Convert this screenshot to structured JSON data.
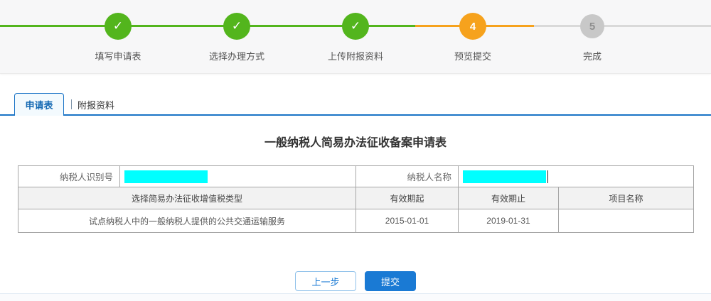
{
  "progress": {
    "steps": [
      {
        "label": "填写申请表",
        "status": "completed"
      },
      {
        "label": "选择办理方式",
        "status": "completed"
      },
      {
        "label": "上传附报资料",
        "status": "completed"
      },
      {
        "label": "预览提交",
        "status": "active",
        "number": "4"
      },
      {
        "label": "完成",
        "status": "pending",
        "number": "5"
      }
    ]
  },
  "icons": {
    "check": "✓"
  },
  "tabs": {
    "application_form": "申请表",
    "attached_materials": "附报资料"
  },
  "form": {
    "title": "一般纳税人简易办法征收备案申请表",
    "taxpayer_id_label": "纳税人识别号",
    "taxpayer_name_label": "纳税人名称",
    "table": {
      "headers": [
        "选择简易办法征收增值税类型",
        "有效期起",
        "有效期止",
        "项目名称"
      ],
      "data_row": {
        "type": "试点纳税人中的一般纳税人提供的公共交通运输服务",
        "valid_from": "2015-01-01",
        "valid_to": "2019-01-31",
        "project_name": ""
      }
    }
  },
  "buttons": {
    "previous": "上一步",
    "submit": "提交"
  },
  "colors": {
    "step_completed_green": "#53b51d",
    "step_active_orange": "#f6a21d",
    "step_pending_gray": "#c8c8c8",
    "accent_blue": "#1a7ad4",
    "redaction_cyan": "#00ffff",
    "topbar_background": "#f7f7f8"
  }
}
